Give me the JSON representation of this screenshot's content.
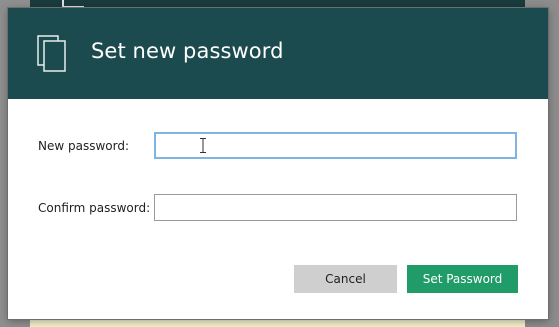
{
  "dialog": {
    "title": "Set new password",
    "icon": "documents-icon"
  },
  "form": {
    "new_password": {
      "label": "New password:",
      "value": "",
      "placeholder": ""
    },
    "confirm_password": {
      "label": "Confirm password:",
      "value": "",
      "placeholder": ""
    }
  },
  "buttons": {
    "cancel_label": "Cancel",
    "set_password_label": "Set Password"
  },
  "colors": {
    "header": "#1c4b4f",
    "primary_button": "#1f9c68",
    "secondary_button": "#cfcfcf",
    "focus_border": "#7fb4e2"
  }
}
